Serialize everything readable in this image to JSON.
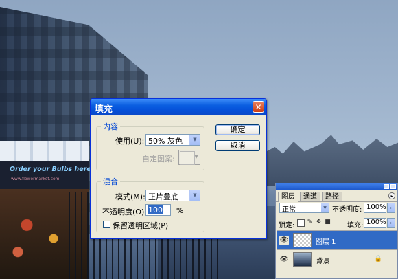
{
  "background": {
    "shop_sign": "Order your Bulbs here",
    "shop_url": "www.flowermarket.com"
  },
  "fill_dialog": {
    "title": "填充",
    "close_glyph": "✕",
    "contents_group": {
      "legend": "内容",
      "use_label": "使用(U):",
      "use_value": "50% 灰色",
      "custom_pattern_label": "自定图案:"
    },
    "blending_group": {
      "legend": "混合",
      "mode_label": "模式(M):",
      "mode_value": "正片叠底",
      "opacity_label": "不透明度(O):",
      "opacity_value": "100",
      "opacity_unit": "%",
      "preserve_transparency_label": "保留透明区域(P)",
      "preserve_transparency_checked": false
    },
    "ok_label": "确定",
    "cancel_label": "取消"
  },
  "layers_panel": {
    "tabs": [
      {
        "label": "图层",
        "active": true
      },
      {
        "label": "通道",
        "active": false
      },
      {
        "label": "路径",
        "active": false
      }
    ],
    "blend_mode": "正常",
    "opacity_label": "不透明度:",
    "opacity_value": "100%",
    "lock_label": "锁定:",
    "fill_label": "填充:",
    "fill_value": "100%",
    "layers": [
      {
        "name": "图层 1",
        "selected": true,
        "visible": true
      },
      {
        "name": "背景",
        "selected": false,
        "visible": true,
        "locked": true
      }
    ]
  },
  "colors": {
    "dialog_title_blue": "#0a5ee0",
    "selection_blue": "#316ac5",
    "dialog_face": "#ece9d8"
  }
}
